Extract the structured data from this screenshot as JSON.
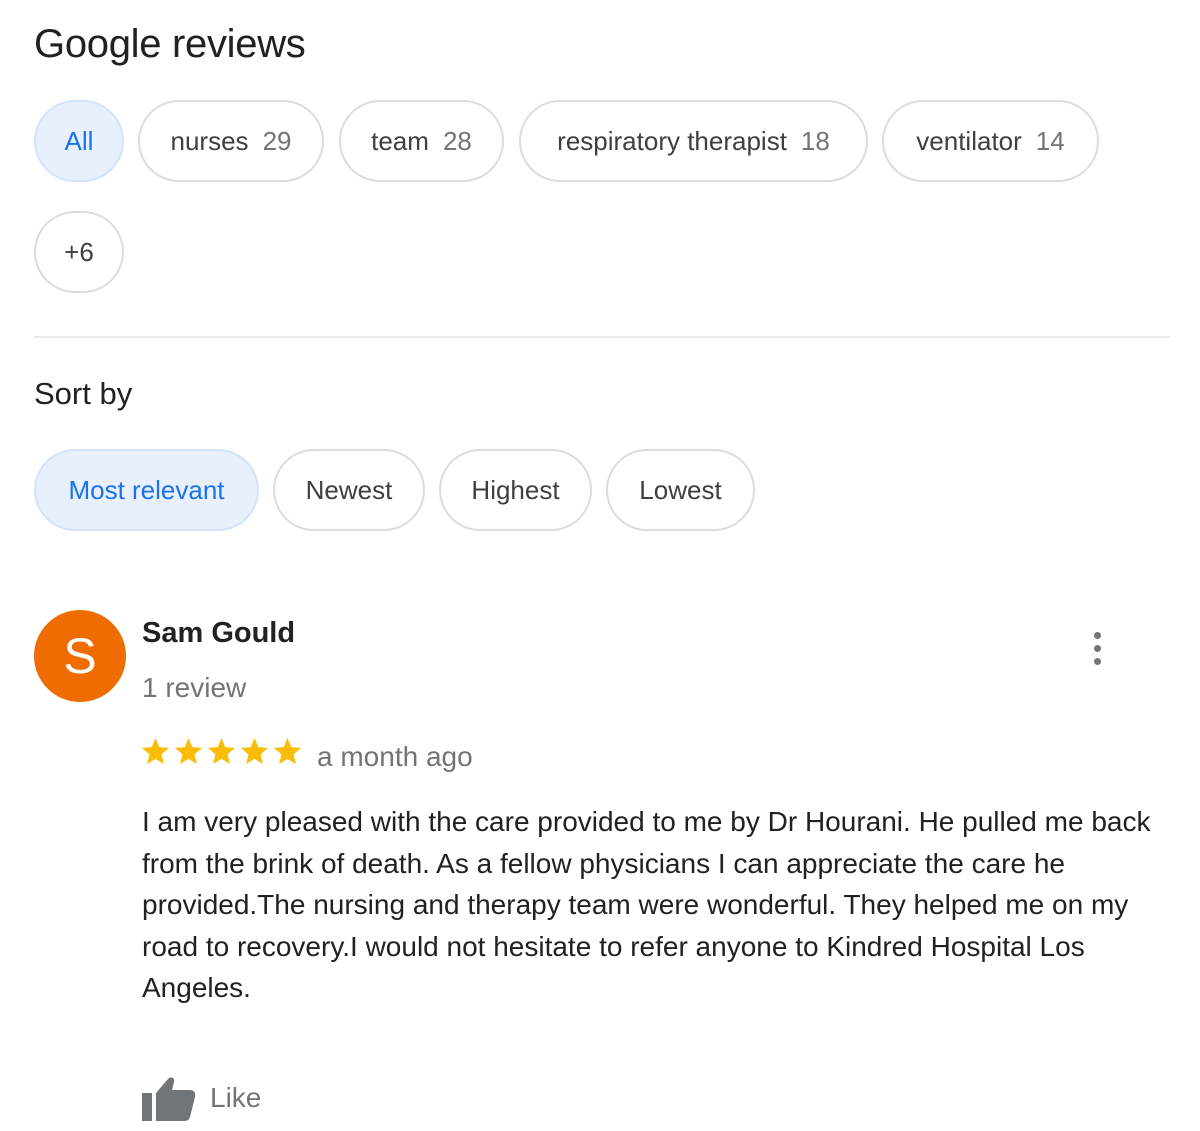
{
  "header": {
    "title": "Google reviews"
  },
  "topic_filters": [
    {
      "label": "All",
      "count": "",
      "active": true
    },
    {
      "label": "nurses",
      "count": "29",
      "active": false
    },
    {
      "label": "team",
      "count": "28",
      "active": false
    },
    {
      "label": "respiratory therapist",
      "count": "18",
      "active": false
    },
    {
      "label": "ventilator",
      "count": "14",
      "active": false
    },
    {
      "label": "+6",
      "count": "",
      "active": false
    }
  ],
  "sort": {
    "label": "Sort by",
    "options": [
      {
        "label": "Most relevant",
        "active": true
      },
      {
        "label": "Newest",
        "active": false
      },
      {
        "label": "Highest",
        "active": false
      },
      {
        "label": "Lowest",
        "active": false
      }
    ]
  },
  "review": {
    "avatar_letter": "S",
    "avatar_color": "#ef6c00",
    "author": "Sam Gould",
    "review_count": "1 review",
    "rating": 5,
    "max_rating": 5,
    "time": "a month ago",
    "text": "I am very pleased with the care provided to me by Dr Hourani. He pulled me back\nfrom the brink of death. As a fellow physicians I can appreciate the care he provided.The nursing and therapy team were wonderful. They helped me on my road to recovery.I would not hesitate to refer anyone to Kindred Hospital Los Angeles.",
    "like_label": "Like",
    "menu_icon": "more-vert-icon",
    "like_icon": "thumbs-up-icon"
  },
  "colors": {
    "accent": "#1a73e8",
    "active_chip_bg": "#e8f0fe",
    "star": "#fbbc04",
    "secondary_text": "#70757a"
  }
}
